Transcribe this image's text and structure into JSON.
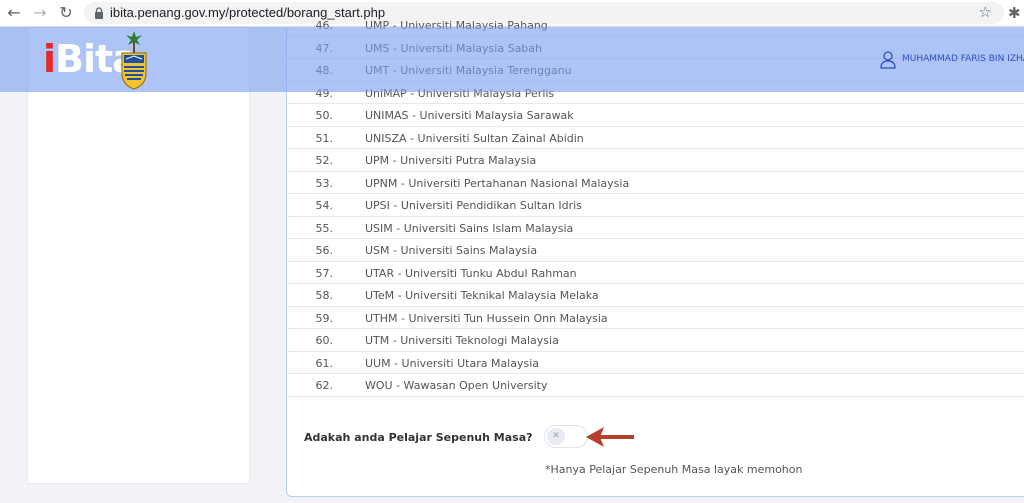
{
  "browser": {
    "url": "ibita.penang.gov.my/protected/borang_start.php"
  },
  "header": {
    "logo_i": "i",
    "logo_bita": "Bita",
    "user_name": "MUHAMMAD FARIS BIN IZHA"
  },
  "universities": [
    {
      "num": "46.",
      "name": "UMP - Universiti Malaysia Pahang"
    },
    {
      "num": "47.",
      "name": "UMS - Universiti Malaysia Sabah"
    },
    {
      "num": "48.",
      "name": "UMT - Universiti Malaysia Terengganu"
    },
    {
      "num": "49.",
      "name": "UniMAP - Universiti Malaysia Perlis"
    },
    {
      "num": "50.",
      "name": "UNIMAS - Universiti Malaysia Sarawak"
    },
    {
      "num": "51.",
      "name": "UNISZA - Universiti Sultan Zainal Abidin"
    },
    {
      "num": "52.",
      "name": "UPM - Universiti Putra Malaysia"
    },
    {
      "num": "53.",
      "name": "UPNM - Universiti Pertahanan Nasional Malaysia"
    },
    {
      "num": "54.",
      "name": "UPSI - Universiti Pendidikan Sultan Idris"
    },
    {
      "num": "55.",
      "name": "USIM - Universiti Sains Islam Malaysia"
    },
    {
      "num": "56.",
      "name": "USM - Universiti Sains Malaysia"
    },
    {
      "num": "57.",
      "name": "UTAR - Universiti Tunku Abdul Rahman"
    },
    {
      "num": "58.",
      "name": "UTeM - Universiti Teknikal Malaysia Melaka"
    },
    {
      "num": "59.",
      "name": "UTHM - Universiti Tun Hussein Onn Malaysia"
    },
    {
      "num": "60.",
      "name": "UTM - Universiti Teknologi Malaysia"
    },
    {
      "num": "61.",
      "name": "UUM - Universiti Utara Malaysia"
    },
    {
      "num": "62.",
      "name": "WOU - Wawasan Open University"
    }
  ],
  "form": {
    "question": "Adakah anda Pelajar Sepenuh Masa?",
    "toggle_on": false,
    "toggle_glyph": "✕",
    "note": "*Hanya Pelajar Sepenuh Masa layak memohon"
  },
  "colors": {
    "header_overlay": "#7da0f0",
    "logo_red": "#e4292c",
    "arrow": "#b5412d",
    "user_name": "#2f4fc0"
  }
}
